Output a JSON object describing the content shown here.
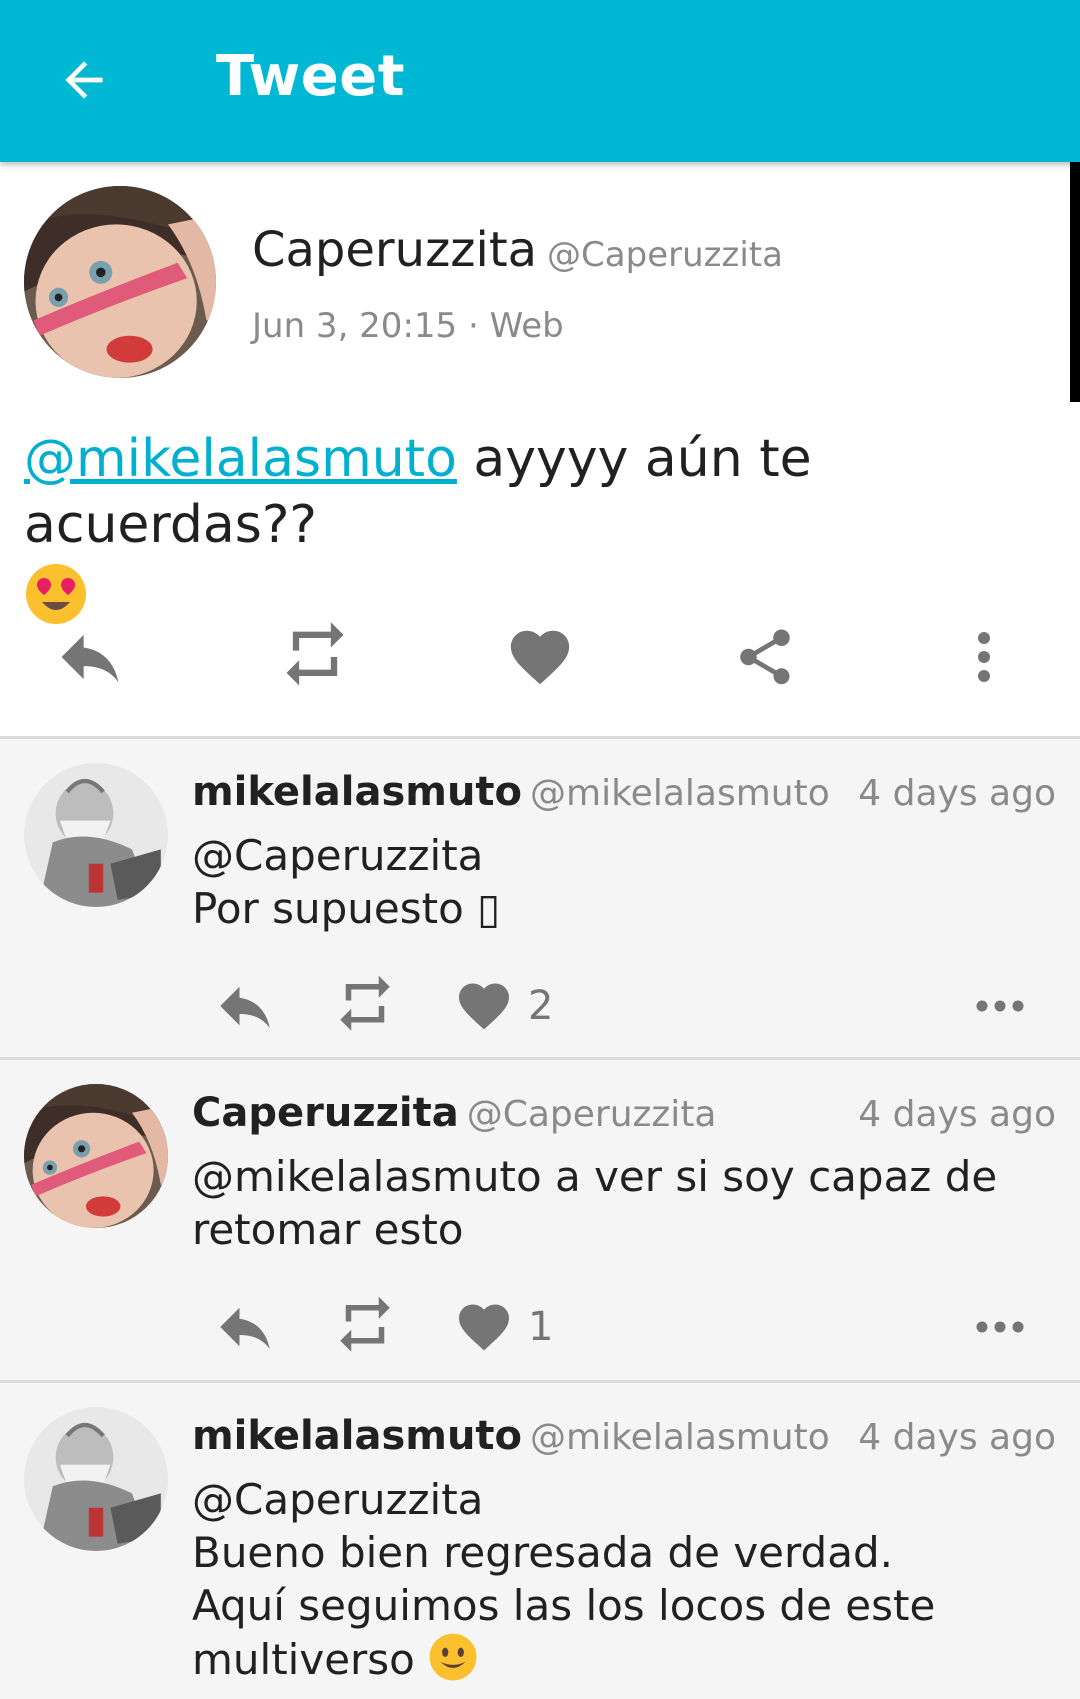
{
  "appbar": {
    "title": "Tweet"
  },
  "tweet": {
    "author_name": "Caperuzzita",
    "author_handle": "@Caperuzzita",
    "meta": "Jun 3, 20:15 · Web",
    "mention": "@mikelalasmuto",
    "text": " ayyyy aún te acuerdas??"
  },
  "replies": [
    {
      "name": "mikelalasmuto",
      "handle": "@mikelalasmuto",
      "time": "4 days ago",
      "text": "@Caperuzzita\nPor supuesto ▯",
      "likes": "2"
    },
    {
      "name": "Caperuzzita",
      "handle": "@Caperuzzita",
      "time": "4 days ago",
      "text": "@mikelalasmuto a ver si soy capaz de retomar esto",
      "likes": "1"
    },
    {
      "name": "mikelalasmuto",
      "handle": "@mikelalasmuto",
      "time": "4 days ago",
      "text": "@Caperuzzita\nBueno bien regresada de verdad.\nAquí seguimos las los locos de este\nmultiverso",
      "likes": ""
    }
  ],
  "colors": {
    "accent": "#00b8d4",
    "mention": "#00b0ce",
    "icon": "#757575"
  },
  "icons": [
    "back-arrow-icon",
    "reply-icon",
    "retweet-icon",
    "heart-icon",
    "share-icon",
    "more-vertical-icon",
    "more-horizontal-icon"
  ]
}
